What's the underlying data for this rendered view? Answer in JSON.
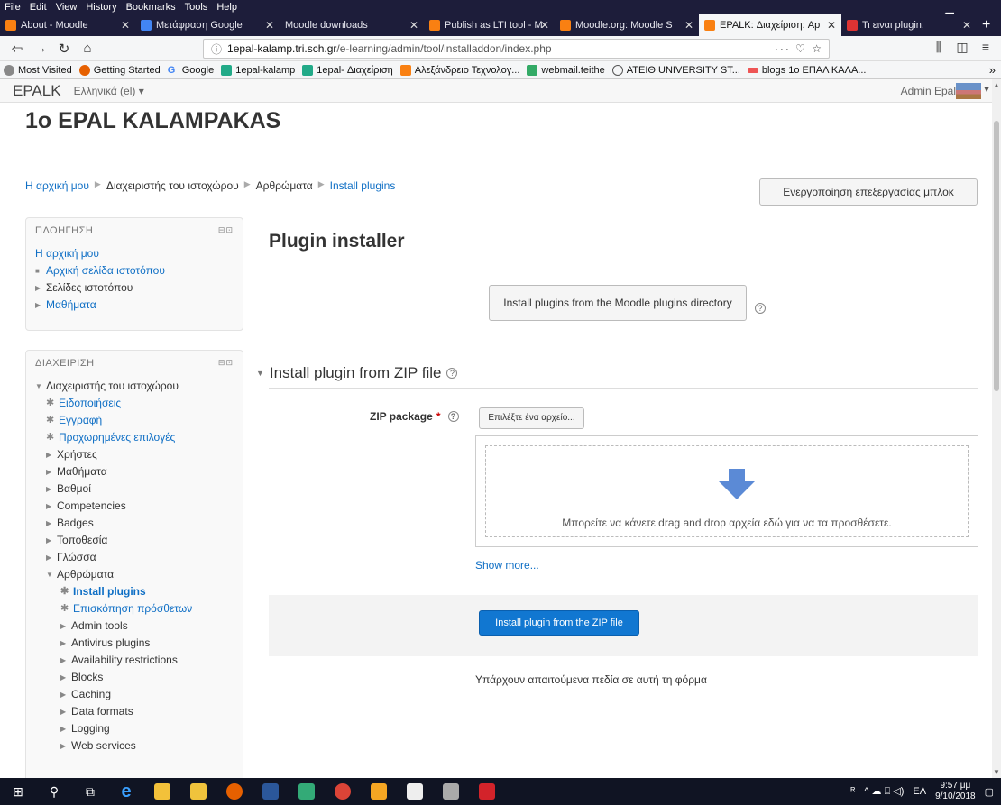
{
  "firefox": {
    "menu": [
      {
        "label": "File"
      },
      {
        "label": "Edit"
      },
      {
        "label": "View"
      },
      {
        "label": "History"
      },
      {
        "label": "Bookmarks"
      },
      {
        "label": "Tools"
      },
      {
        "label": "Help"
      }
    ],
    "tabs": [
      {
        "label": "About - Moodle",
        "color": "#f98012"
      },
      {
        "label": "Μετάφραση Google",
        "color": "#4285f4"
      },
      {
        "label": "Moodle downloads",
        "color": "#1d1d3a"
      },
      {
        "label": "Publish as LTI tool - M",
        "color": "#f98012"
      },
      {
        "label": "Moodle.org: Moodle S",
        "color": "#f98012"
      },
      {
        "label": "EPALK: Διαχείριση: Ap",
        "color": "#f98012"
      },
      {
        "label": "Τι ειναι plugin;",
        "color": "#d33"
      }
    ],
    "url": {
      "domain": "1epal-kalamp.tri.sch.gr",
      "path": "/e-learning/admin/tool/installaddon/index.php"
    },
    "bookmarks": [
      {
        "label": "Most Visited",
        "color": "#888"
      },
      {
        "label": "Getting Started",
        "color": "#e66000"
      },
      {
        "label": "Google",
        "color": "#4285f4"
      },
      {
        "label": "1epal-kalamp",
        "color": "#2a8"
      },
      {
        "label": "1epal- Διαχείριση",
        "color": "#2a8"
      },
      {
        "label": "Αλεξάνδρειο Τεχνολογ...",
        "color": "#f98012"
      },
      {
        "label": "webmail.teithe",
        "color": "#3a6"
      },
      {
        "label": "ATEIΘ UNIVERSITY ST...",
        "color": "#555"
      },
      {
        "label": "blogs 1ο ΕΠΑΛ ΚΑΛΑ...",
        "color": "#e55"
      }
    ]
  },
  "header": {
    "brand": "EPALK",
    "language": "Ελληνικά (el) ▾",
    "user": "Admin Epal"
  },
  "site_title": "1o EPAL KALAMPAKAS",
  "breadcrumb": [
    "Η αρχική μου",
    "Διαχειριστής του ιστοχώρου",
    "Αρθρώματα",
    "Install plugins"
  ],
  "edit_blocks_button": "Ενεργοποίηση επεξεργασίας μπλοκ",
  "navigation": {
    "title": "ΠΛΟΗΓΗΣΗ",
    "home": "Η αρχική μου",
    "items": [
      "Αρχική σελίδα ιστοτόπου",
      "Σελίδες ιστοτόπου",
      "Μαθήματα"
    ]
  },
  "admin": {
    "title": "ΔΙΑΧΕΙΡΙΣΗ",
    "root": "Διαχειριστής του ιστοχώρου",
    "settings": [
      "Ειδοποιήσεις",
      "Εγγραφή",
      "Προχωρημένες επιλογές"
    ],
    "categories": [
      "Χρήστες",
      "Μαθήματα",
      "Βαθμοί",
      "Competencies",
      "Badges",
      "Τοποθεσία",
      "Γλώσσα"
    ],
    "plugins": "Αρθρώματα",
    "plugin_links": [
      "Install plugins",
      "Επισκόπηση πρόσθετων"
    ],
    "plugin_categories": [
      "Admin tools",
      "Antivirus plugins",
      "Availability restrictions",
      "Blocks",
      "Caching",
      "Data formats",
      "Logging",
      "Web services"
    ]
  },
  "main": {
    "heading": "Plugin installer",
    "directory_button": "Install plugins from the Moodle plugins directory",
    "legend": "Install plugin from ZIP file",
    "zip_label": "ZIP package",
    "required_mark": "*",
    "choose_file": "Επιλέξτε ένα αρχείο...",
    "drop_text": "Μπορείτε να κάνετε drag and drop αρχεία εδώ για να τα προσθέσετε.",
    "show_more": "Show more...",
    "install_button": "Install plugin from the ZIP file",
    "required_note": "Υπάρχουν απαιτούμενα πεδία σε αυτή τη φόρμα"
  },
  "taskbar": {
    "time": "9:57 μμ",
    "date": "9/10/2018",
    "lang": "ΕΛ"
  }
}
